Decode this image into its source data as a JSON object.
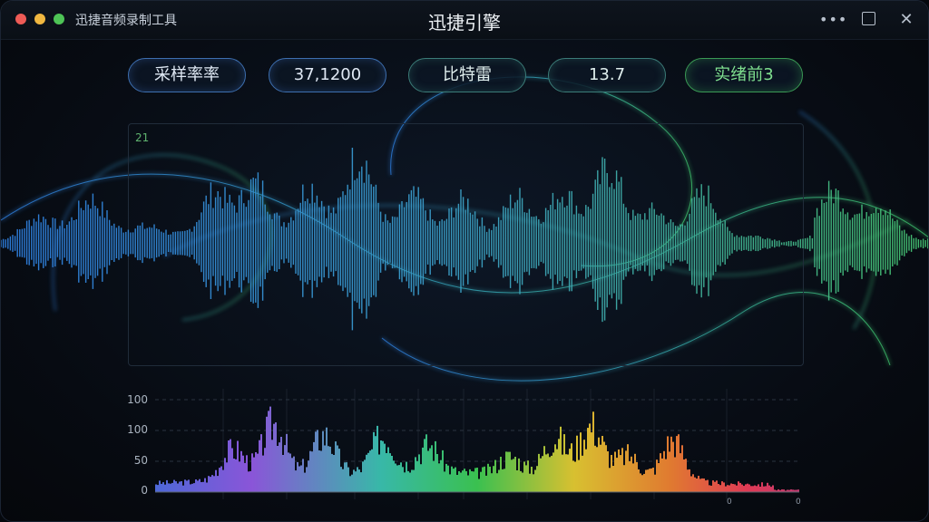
{
  "window": {
    "app_name": "迅捷音频录制工具",
    "title": "迅捷引擎",
    "more_icon": "more-horizontal-icon",
    "maximize_icon": "maximize-icon",
    "close_icon": "close-icon"
  },
  "params": [
    {
      "label": "采样率率",
      "style": "blue"
    },
    {
      "label": "37,1200",
      "style": "blue"
    },
    {
      "label": "比特雷",
      "style": "teal"
    },
    {
      "label": "13.7",
      "style": "teal"
    },
    {
      "label": "实绪前3",
      "style": "green"
    }
  ],
  "waveform": {
    "label": "21",
    "colors": [
      "#2f7fe0",
      "#3aa0c8",
      "#46c07a"
    ]
  },
  "spectrum": {
    "y_ticks": [
      "100",
      "100",
      "50",
      "0"
    ],
    "x_ticks": [
      "0",
      "0"
    ],
    "colors": [
      "#5b6fe0",
      "#a05ce0",
      "#3ac0a0",
      "#3ac050",
      "#e0c030",
      "#e07030",
      "#e03050"
    ]
  }
}
